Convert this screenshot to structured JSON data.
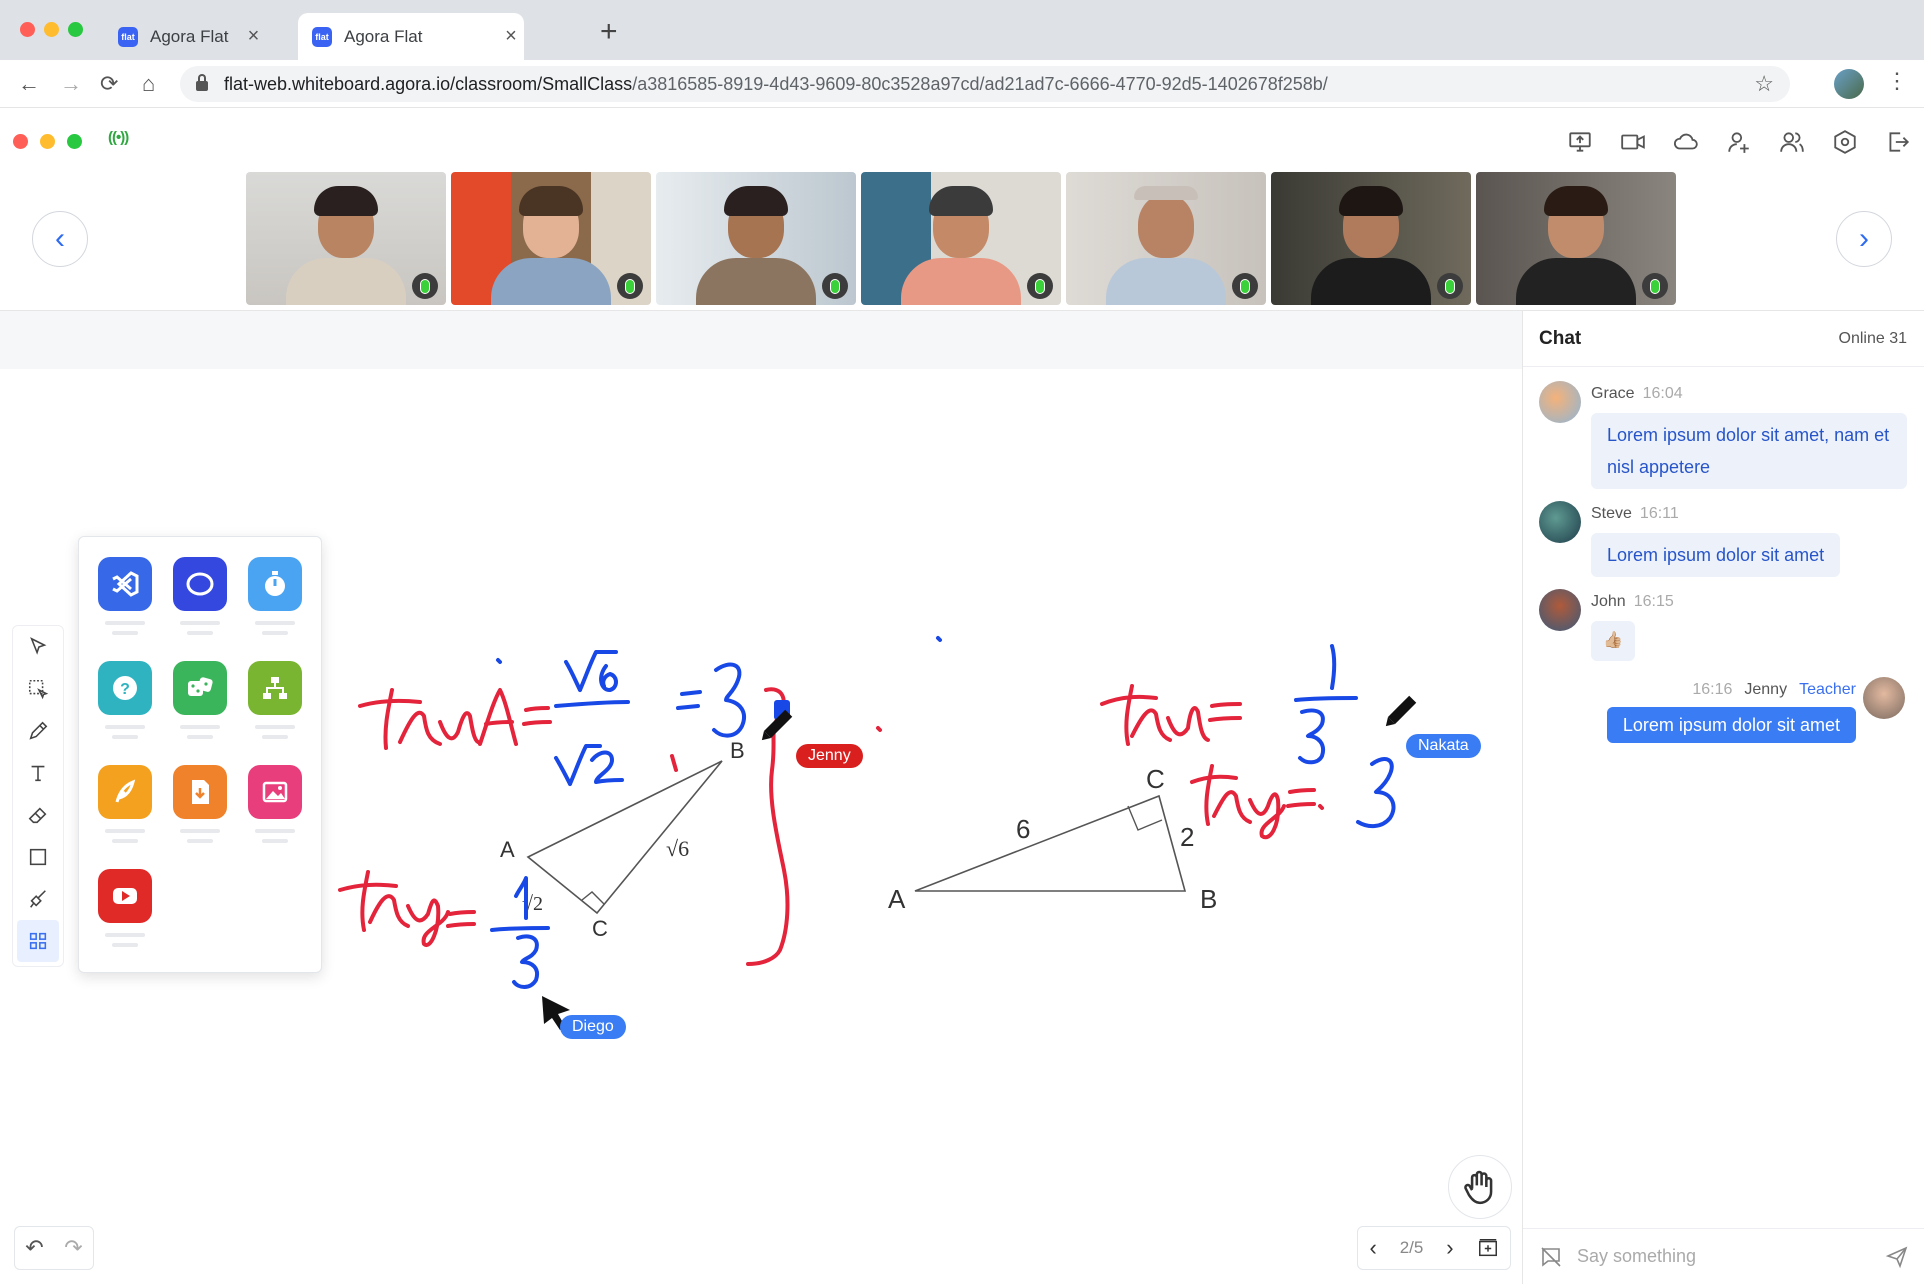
{
  "browser": {
    "tabs": [
      {
        "label": "Agora Flat",
        "favicon": "flat-logo-icon"
      },
      {
        "label": "Agora Flat",
        "favicon": "flat-logo-icon"
      }
    ],
    "new_tab": "+",
    "url_host": "flat-web.whiteboard.agora.io/classroom/SmallClass",
    "url_path": "/a3816585-8919-4d43-9609-80c3528a97cd/ad21ad7c-6666-4770-92d5-1402678f258b/",
    "favicon_label": "flat"
  },
  "header": {
    "signal": "((•))",
    "icons": [
      "share-screen-icon",
      "camera-icon",
      "cloud-icon",
      "invite-user-icon",
      "users-icon",
      "settings-icon",
      "exit-icon"
    ]
  },
  "video_strip": {
    "prev": "‹",
    "next": "›",
    "participants": 7
  },
  "whiteboard": {
    "tools": [
      "pointer-icon",
      "selector-icon",
      "pencil-icon",
      "text-icon",
      "eraser-icon",
      "rectangle-icon",
      "clear-icon",
      "apps-icon"
    ],
    "apps": [
      "vscode-app-icon",
      "whiteboard-app-icon",
      "countdown-app-icon",
      "quiz-app-icon",
      "dice-app-icon",
      "mindmap-app-icon",
      "geogebra-app-icon",
      "download-app-icon",
      "image-app-icon",
      "youtube-app-icon"
    ],
    "cursors": [
      {
        "name": "Jenny",
        "color": "#e02020"
      },
      {
        "name": "Nakata",
        "color": "#3a7cf4"
      },
      {
        "name": "Diego",
        "color": "#3a7cf4"
      }
    ],
    "left_triangle": {
      "A": "A",
      "B": "B",
      "C": "C",
      "side_bc": "√6",
      "side_ac": "√2"
    },
    "right_triangle": {
      "A": "A",
      "B": "B",
      "C": "C",
      "side_ac": "6",
      "side_cb": "2"
    },
    "pager": {
      "prev": "‹",
      "current": "2/5",
      "next": "›"
    },
    "undo": "↶",
    "redo": "↷"
  },
  "chat": {
    "title": "Chat",
    "online": "Online 31",
    "messages": [
      {
        "name": "Grace",
        "time": "16:04",
        "text": "Lorem ipsum dolor sit amet, nam et nisl appetere"
      },
      {
        "name": "Steve",
        "time": "16:11",
        "text": "Lorem ipsum dolor sit amet"
      },
      {
        "name": "John",
        "time": "16:15",
        "text": "👍🏼"
      },
      {
        "name": "Jenny",
        "time": "16:16",
        "role": "Teacher",
        "text": "Lorem ipsum dolor sit amet"
      }
    ],
    "input_placeholder": "Say something"
  },
  "colors": {
    "accent": "#3a7cf4",
    "ink_red": "#e3243b",
    "ink_blue": "#1848e6"
  }
}
